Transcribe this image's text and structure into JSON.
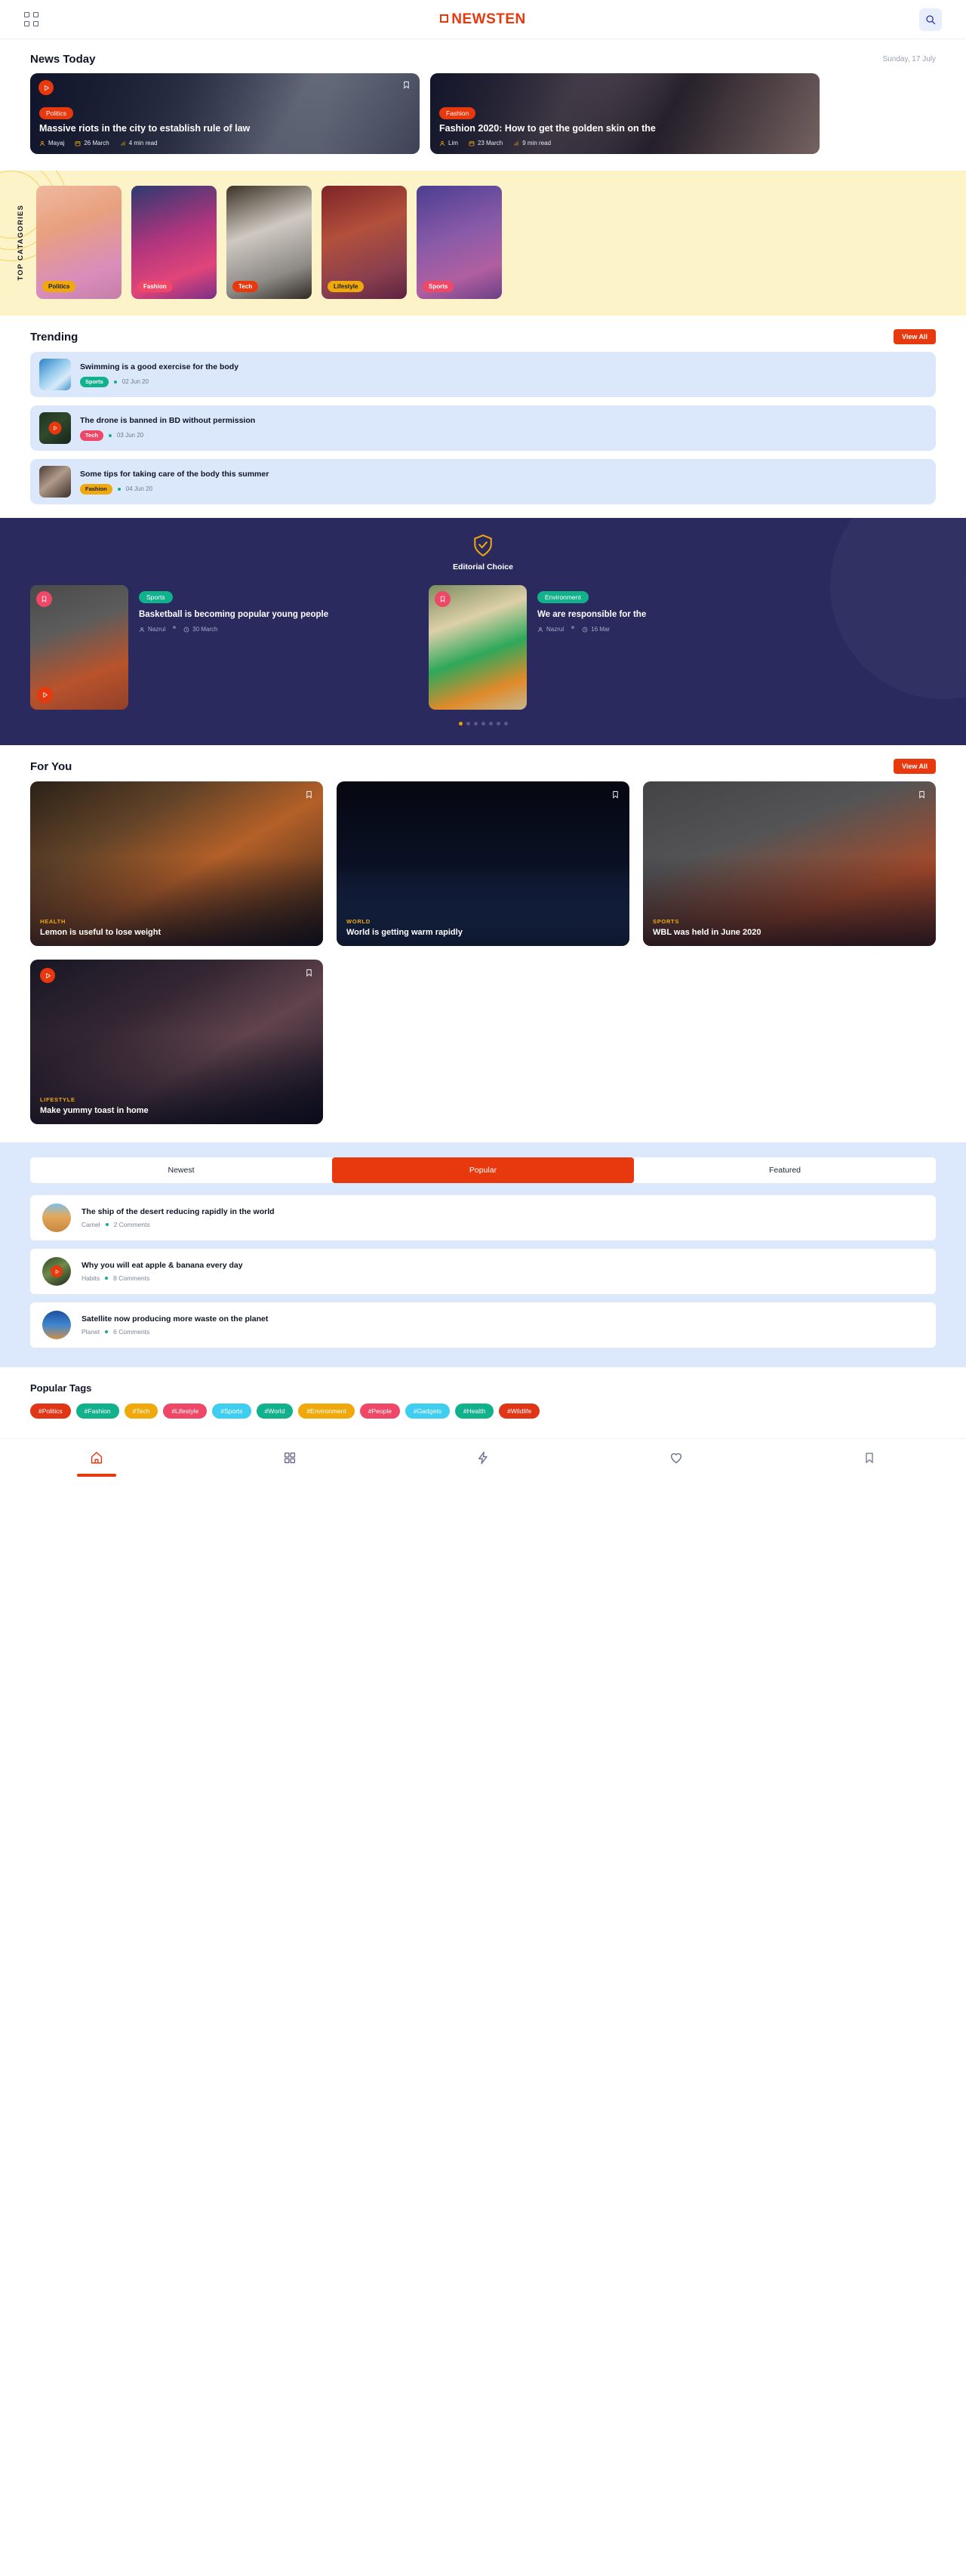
{
  "header": {
    "menu_icon": "grid-menu-icon",
    "brand": "NEWSTEN",
    "search_icon": "search-icon",
    "accent": "#e8380d"
  },
  "news_today": {
    "title": "News Today",
    "date": "Sunday, 17 July",
    "cards": [
      {
        "category": "Politics",
        "title": "Massive riots in the city to establish rule of law",
        "author": "Mayaj",
        "date": "26 March",
        "read_time": "4 min read",
        "image": "img-riot",
        "has_play": true,
        "has_bookmark": true
      },
      {
        "category": "Fashion",
        "title": "Fashion 2020: How to get the golden skin on the",
        "author": "Lim",
        "date": "23 March",
        "read_time": "9 min read",
        "image": "img-fashion",
        "has_play": false,
        "has_bookmark": false
      }
    ]
  },
  "top_categories": {
    "label": "TOP CATAGORIES",
    "items": [
      {
        "label": "Politics",
        "color": "#f0a90c",
        "text_color": "#1a1a1a",
        "image": "img-politics"
      },
      {
        "label": "Fashion",
        "color": "#ef4767",
        "text_color": "#ffffff",
        "image": "img-fashgirl"
      },
      {
        "label": "Tech",
        "color": "#e8380d",
        "text_color": "#ffffff",
        "image": "img-tech"
      },
      {
        "label": "Lifestyle",
        "color": "#f0a90c",
        "text_color": "#1a1a1a",
        "image": "img-lifestyle"
      },
      {
        "label": "Sports",
        "color": "#ef4767",
        "text_color": "#ffffff",
        "image": "img-sports"
      }
    ]
  },
  "trending": {
    "title": "Trending",
    "view_all": "View All",
    "items": [
      {
        "title": "Swimming is a good exercise for the body",
        "category": "Sports",
        "chip_color": "#11b18c",
        "date": "02 Jun 20",
        "image": "img-swim",
        "has_play": false
      },
      {
        "title": "The drone is banned in BD without permission",
        "category": "Tech",
        "chip_color": "#ef4767",
        "date": "03 Jun 20",
        "image": "img-drone",
        "has_play": true
      },
      {
        "title": "Some tips for taking care of the body this summer",
        "category": "Fashion",
        "chip_color": "#f0a90c",
        "date": "04 Jun 20",
        "image": "img-girl",
        "has_play": false
      }
    ]
  },
  "editorial": {
    "shield_icon": "shield-check-icon",
    "label": "Editorial Choice",
    "cards": [
      {
        "category": "Sports",
        "title": "Basketball is becoming popular young people",
        "author": "Nazrul",
        "date": "30 March",
        "image": "img-court",
        "has_play": true
      },
      {
        "category": "Environment",
        "title": "We are responsible for the",
        "author": "Nazrul",
        "date": "16 Mar",
        "image": "img-eco",
        "has_play": false
      }
    ],
    "dots_total": 7,
    "dots_active": 0
  },
  "for_you": {
    "title": "For You",
    "view_all": "View All",
    "cards": [
      {
        "category": "HEALTH",
        "title": "Lemon is useful to lose weight",
        "image": "img-citrus",
        "has_play": false
      },
      {
        "category": "WORLD",
        "title": "World is getting warm rapidly",
        "image": "img-earth",
        "has_play": false
      },
      {
        "category": "SPORTS",
        "title": "WBL was held in June 2020",
        "image": "img-court",
        "has_play": false
      },
      {
        "category": "LIFESTYLE",
        "title": "Make yummy toast in home",
        "image": "img-toast",
        "has_play": true
      }
    ]
  },
  "comments_section": {
    "tabs": [
      {
        "label": "Newest",
        "active": false
      },
      {
        "label": "Popular",
        "active": true
      },
      {
        "label": "Featured",
        "active": false
      }
    ],
    "items": [
      {
        "title": "The ship of the desert reducing rapidly in the world",
        "source": "Camel",
        "comments": "2 Comments",
        "image": "img-desert",
        "has_play": false
      },
      {
        "title": "Why you will eat apple & banana every day",
        "source": "Habits",
        "comments": "8 Comments",
        "image": "img-habits",
        "has_play": true
      },
      {
        "title": "Satellite now producing more waste on the planet",
        "source": "Planet",
        "comments": "6 Comments",
        "image": "img-planet",
        "has_play": false
      }
    ]
  },
  "popular_tags": {
    "title": "Popular Tags",
    "tags": [
      {
        "label": "#Politics",
        "color": "#e03516"
      },
      {
        "label": "#Fashion",
        "color": "#11b18c"
      },
      {
        "label": "#Tech",
        "color": "#f0a90c"
      },
      {
        "label": "#Lifestyle",
        "color": "#ef4767"
      },
      {
        "label": "#Sports",
        "color": "#3fcdf0"
      },
      {
        "label": "#World",
        "color": "#11b18c"
      },
      {
        "label": "#Environment",
        "color": "#f0a90c"
      },
      {
        "label": "#People",
        "color": "#ef4767"
      },
      {
        "label": "#Gadgets",
        "color": "#3fcdf0"
      },
      {
        "label": "#Health",
        "color": "#11b18c"
      },
      {
        "label": "#Wildlife",
        "color": "#e03516"
      }
    ]
  },
  "bottom_nav": {
    "items": [
      {
        "icon": "home-icon",
        "active": true
      },
      {
        "icon": "grid-icon",
        "active": false
      },
      {
        "icon": "flash-icon",
        "active": false
      },
      {
        "icon": "heart-icon",
        "active": false
      },
      {
        "icon": "bookmark-icon",
        "active": false
      }
    ]
  }
}
